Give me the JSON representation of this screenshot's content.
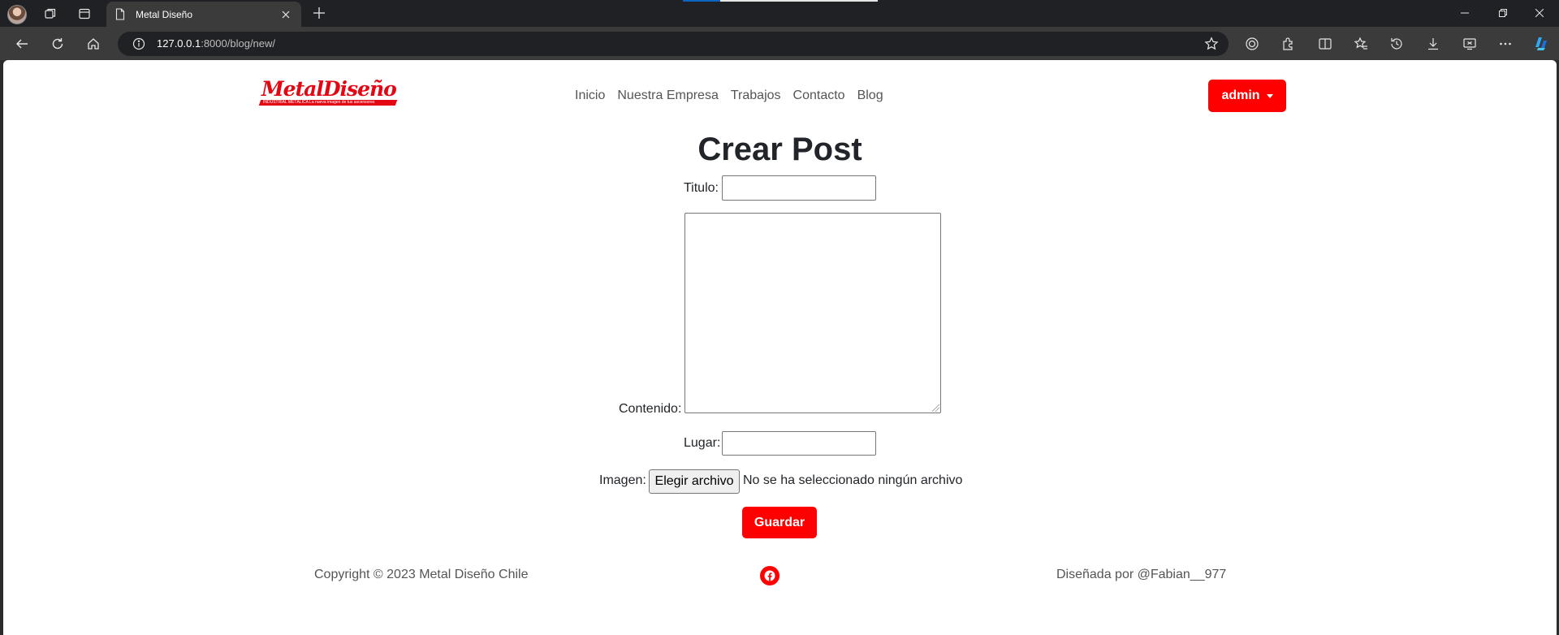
{
  "browser": {
    "tab_title": "Metal Diseño",
    "url_host": "127.0.0.1",
    "url_rest": ":8000/blog/new/"
  },
  "site": {
    "logo_text": "MetalDiseño",
    "logo_tagline": "INDUSTRIAL METÁLICA    La nueva imagen de tus ascensores",
    "nav": [
      "Inicio",
      "Nuestra Empresa",
      "Trabajos",
      "Contacto",
      "Blog"
    ],
    "user_menu_label": "admin"
  },
  "form": {
    "heading": "Crear Post",
    "titulo_label": "Titulo:",
    "titulo_value": "",
    "contenido_label": "Contenido:",
    "contenido_value": "",
    "lugar_label": "Lugar:",
    "lugar_value": "",
    "imagen_label": "Imagen:",
    "file_button_label": "Elegir archivo",
    "file_status": "No se ha seleccionado ningún archivo",
    "submit_label": "Guardar"
  },
  "footer": {
    "copyright": "Copyright © 2023 Metal Diseño Chile",
    "credit": "Diseñada por @Fabian__977",
    "social_icon": "facebook-icon"
  },
  "colors": {
    "brand_red": "#ff0000",
    "logo_red": "#e30613",
    "text": "#212529",
    "muted": "#555555"
  }
}
